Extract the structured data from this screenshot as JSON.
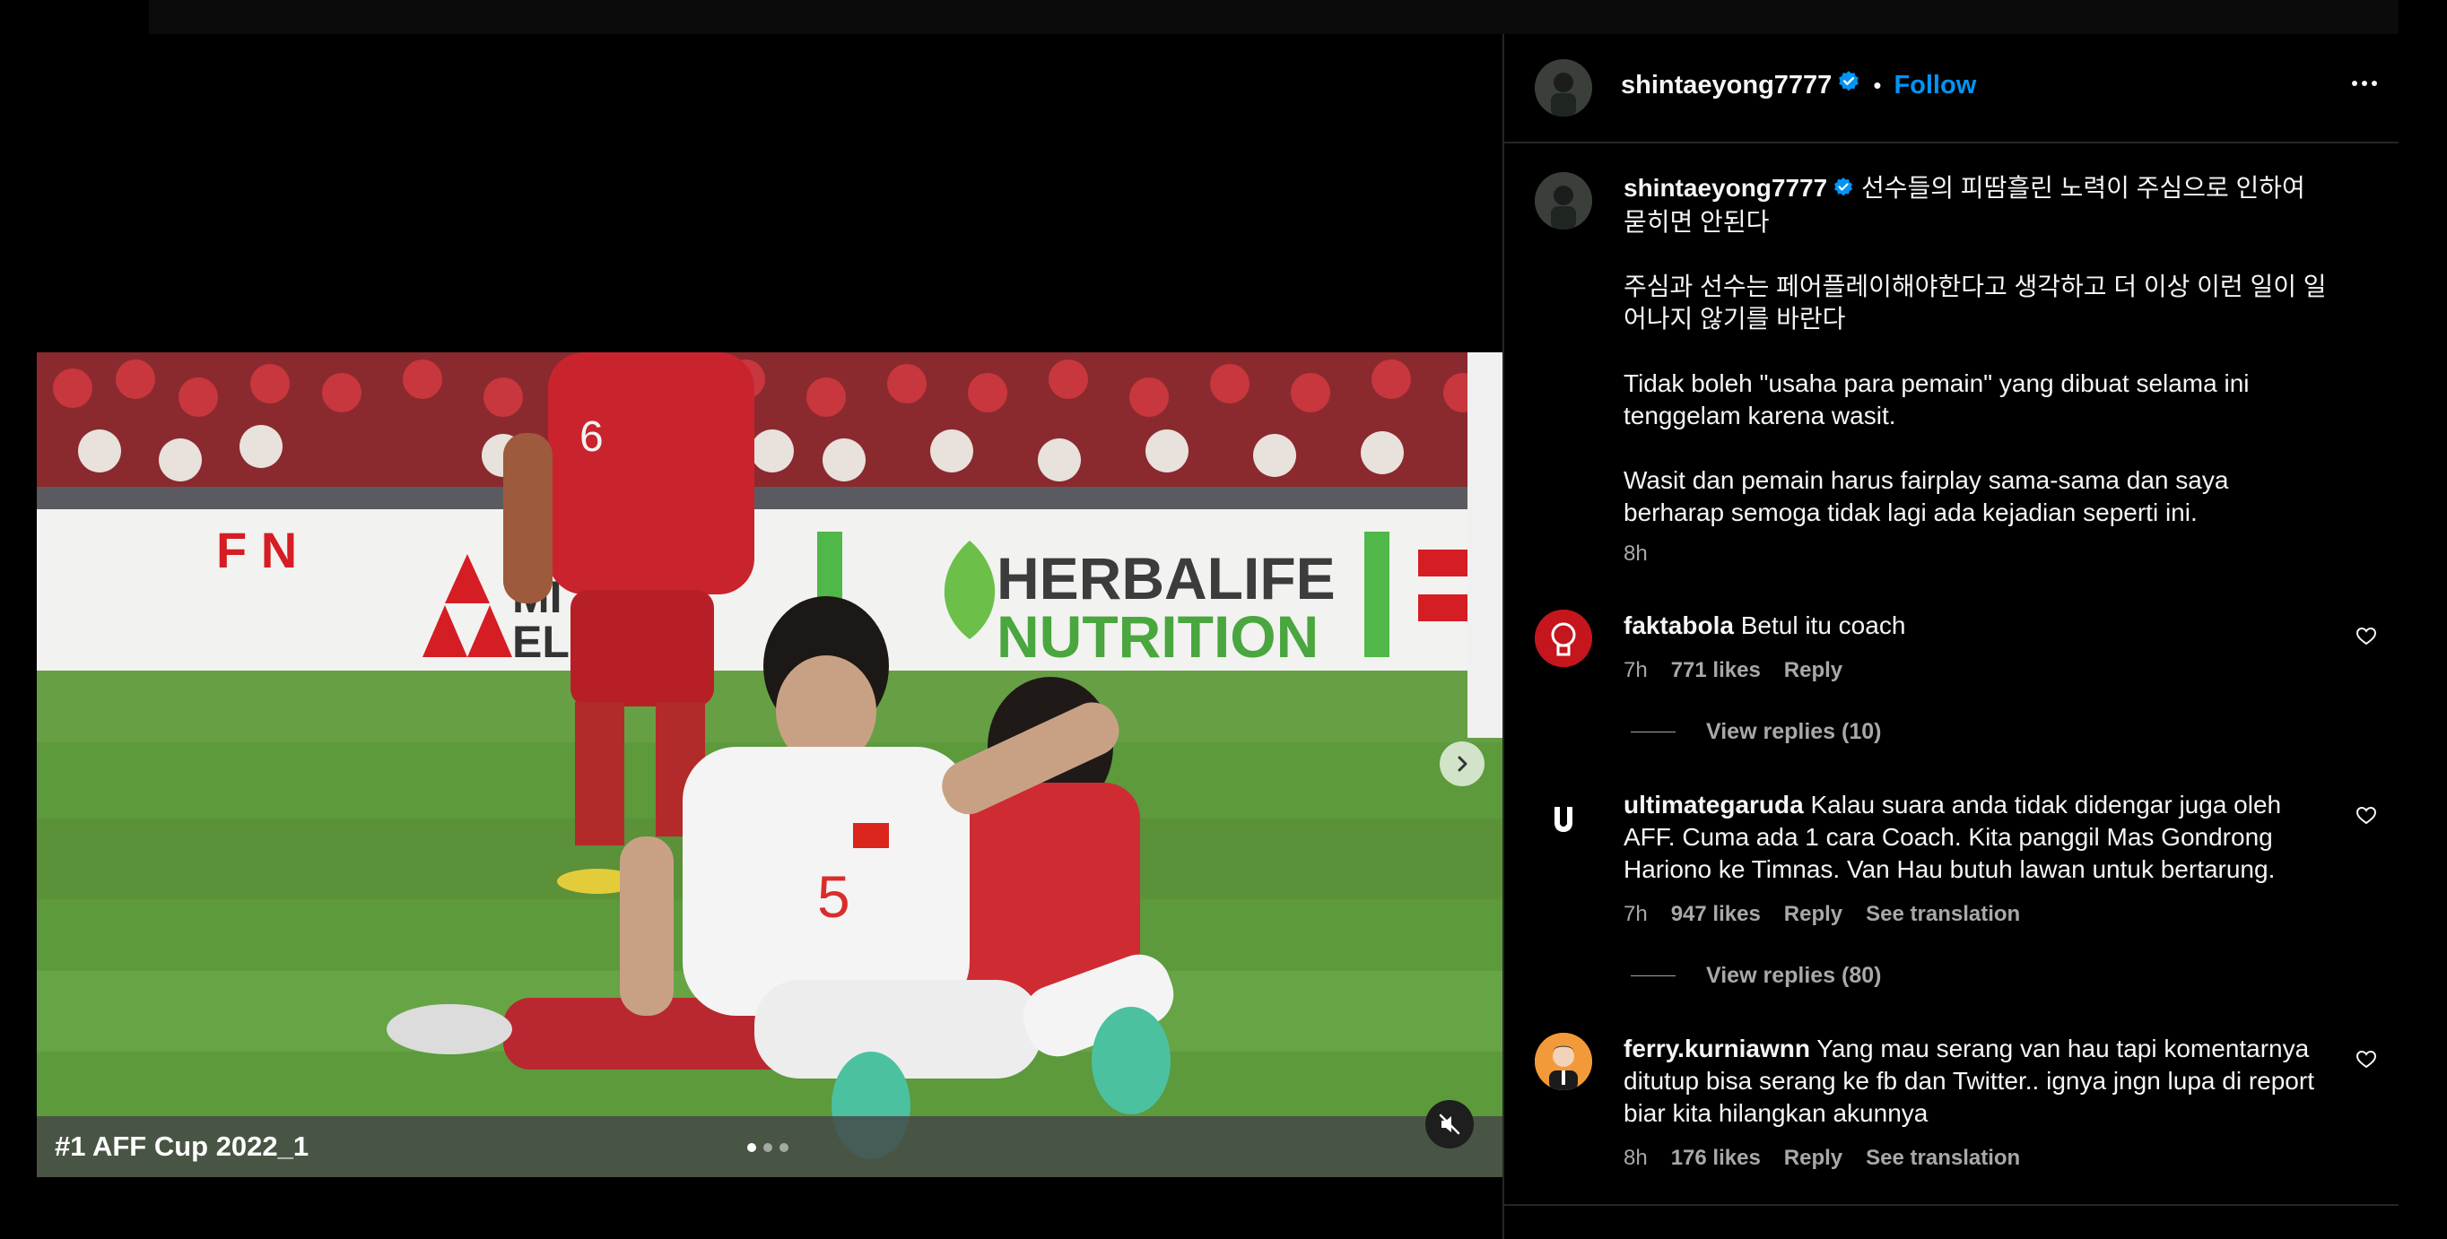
{
  "post": {
    "media": {
      "caption": "#1 AFF Cup 2022_1",
      "carousel": {
        "count": 3,
        "active": 1
      },
      "board_text": "HERBALIFE NUTRITION",
      "board_line1": "HERBALIFE",
      "board_line2": "NUTRITION",
      "board_fragment": "F N",
      "mitsu_fragment1": "MI",
      "mitsu_fragment2": "EL",
      "shirt_number_red": "6",
      "shirt_number_white": "5"
    },
    "header": {
      "username": "shintaeyong7777",
      "separator": "•",
      "follow_label": "Follow",
      "more_icon": "more-horizontal-icon"
    },
    "caption": {
      "username": "shintaeyong7777",
      "paragraphs": [
        "선수들의 피땀흘린 노력이 주심으로 인하여 묻히면 안된다",
        "주심과 선수는 페어플레이해야한다고 생각하고 더 이상 이런 일이 일어나지 않기를 바란다",
        "Tidak boleh \"usaha para pemain\" yang dibuat selama ini tenggelam karena wasit.",
        "Wasit dan pemain harus fairplay sama-sama dan saya berharap semoga tidak lagi ada kejadian seperti ini."
      ],
      "time": "8h"
    },
    "comments": [
      {
        "username": "faktabola",
        "text": "Betul itu coach",
        "time": "7h",
        "likes": "771 likes",
        "reply_label": "Reply",
        "view_replies": "View replies (10)"
      },
      {
        "username": "ultimategaruda",
        "text": "Kalau suara anda tidak didengar juga oleh AFF. Cuma ada 1 cara Coach. Kita panggil Mas Gondrong Hariono ke Timnas. Van Hau butuh lawan untuk bertarung.",
        "time": "7h",
        "likes": "947 likes",
        "reply_label": "Reply",
        "translation_label": "See translation",
        "view_replies": "View replies (80)"
      },
      {
        "username": "ferry.kurniawnn",
        "text": "Yang mau serang van hau tapi komentarnya ditutup bisa serang ke fb dan Twitter.. ignya jngn lupa di report biar kita hilangkan akunnya",
        "time": "8h",
        "likes": "176 likes",
        "reply_label": "Reply",
        "translation_label": "See translation"
      }
    ]
  },
  "colors": {
    "background": "#000000",
    "link_blue": "#0095f6",
    "secondary_text": "#a8a8a8",
    "divider": "#262626",
    "verified_badge": "#0095f6"
  }
}
